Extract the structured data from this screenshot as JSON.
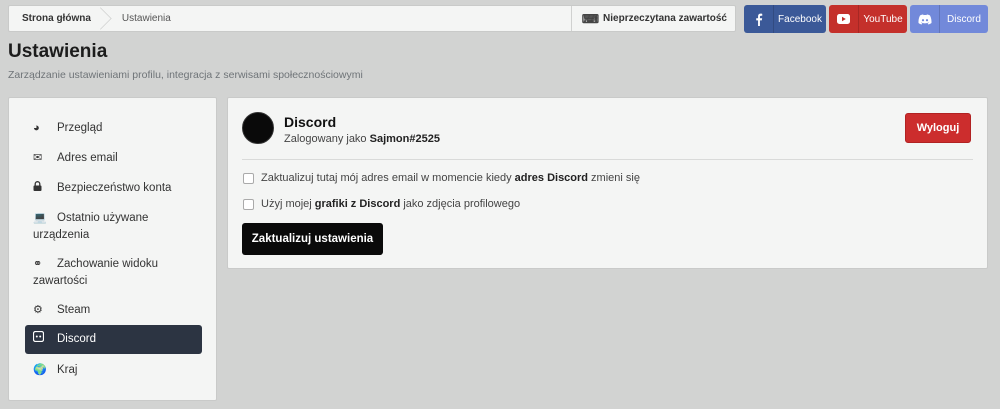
{
  "breadcrumb": {
    "home": "Strona główna",
    "current": "Ustawienia"
  },
  "unread": {
    "label": "Nieprzeczytana zawartość",
    "icon": "keyboard-icon"
  },
  "social": [
    {
      "label": "Facebook",
      "icon": "facebook-icon",
      "color": "#3b5998"
    },
    {
      "label": "YouTube",
      "icon": "youtube-icon",
      "color": "#c4302b"
    },
    {
      "label": "Discord",
      "icon": "discord-icon",
      "color": "#7289da"
    }
  ],
  "page": {
    "title": "Ustawienia",
    "subtitle": "Zarządzanie ustawieniami profilu, integracja z serwisami społecznościowymi"
  },
  "sidebar": {
    "items": [
      {
        "label": "Przegląd",
        "icon": "dashboard-icon"
      },
      {
        "label": "Adres email",
        "icon": "envelope-icon"
      },
      {
        "label": "Bezpieczeństwo konta",
        "icon": "lock-icon"
      },
      {
        "label": "Ostatnio używane urządzenia",
        "icon": "laptop-icon"
      },
      {
        "label": "Zachowanie widoku zawartości",
        "icon": "link-icon"
      },
      {
        "label": "Steam",
        "icon": "steam-icon"
      },
      {
        "label": "Discord",
        "icon": "discord-icon",
        "active": true
      },
      {
        "label": "Kraj",
        "icon": "globe-icon"
      }
    ]
  },
  "discord": {
    "title": "Discord",
    "logged_prefix": "Zalogowany jako",
    "username": "Sajmon#2525",
    "logout_label": "Wyloguj",
    "option1": {
      "before": "Zaktualizuj tutaj mój adres email w momencie kiedy",
      "bold": "adres Discord",
      "after": "zmieni się",
      "checked": false
    },
    "option2": {
      "before": "Użyj mojej",
      "bold": "grafiki z Discord",
      "after": "jako zdjęcia profilowego",
      "checked": false
    },
    "submit_label": "Zaktualizuj ustawienia"
  },
  "colors": {
    "active_nav": "#2c3442",
    "logout": "#cc2d2d",
    "submit": "#0a0a0a"
  }
}
